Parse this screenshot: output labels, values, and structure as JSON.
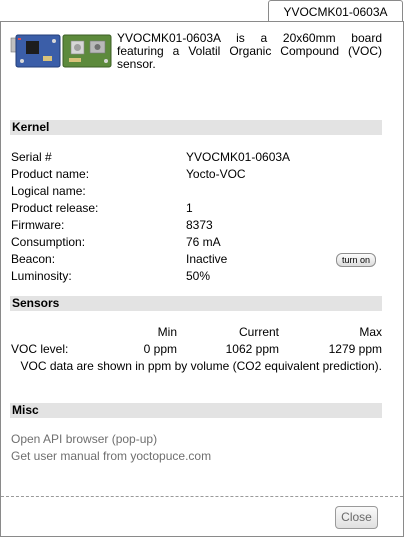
{
  "tab_title": "YVOCMK01-0603A",
  "header": {
    "description": "YVOCMK01-0603A is a 20x60mm board featuring a Volatil Organic Compound (VOC) sensor."
  },
  "kernel": {
    "title": "Kernel",
    "rows": [
      {
        "label": "Serial #",
        "value": "YVOCMK01-0603A"
      },
      {
        "label": "Product name:",
        "value": "Yocto-VOC"
      },
      {
        "label": "Logical name:",
        "value": ""
      },
      {
        "label": "Product release:",
        "value": "1"
      },
      {
        "label": "Firmware:",
        "value": "8373"
      },
      {
        "label": "Consumption:",
        "value": "76 mA"
      },
      {
        "label": "Beacon:",
        "value": "Inactive"
      },
      {
        "label": "Luminosity:",
        "value": "50%"
      }
    ],
    "beacon_button": "turn on"
  },
  "sensors": {
    "title": "Sensors",
    "headers": {
      "min": "Min",
      "current": "Current",
      "max": "Max"
    },
    "voc": {
      "label": "VOC level:",
      "min": "0 ppm",
      "current": "1062 ppm",
      "max": "1279 ppm"
    },
    "note": "VOC data are shown in ppm by volume (CO2 equivalent prediction)."
  },
  "misc": {
    "title": "Misc",
    "links": [
      "Open API browser (pop-up)",
      "Get user manual from yoctopuce.com"
    ]
  },
  "close_label": "Close"
}
